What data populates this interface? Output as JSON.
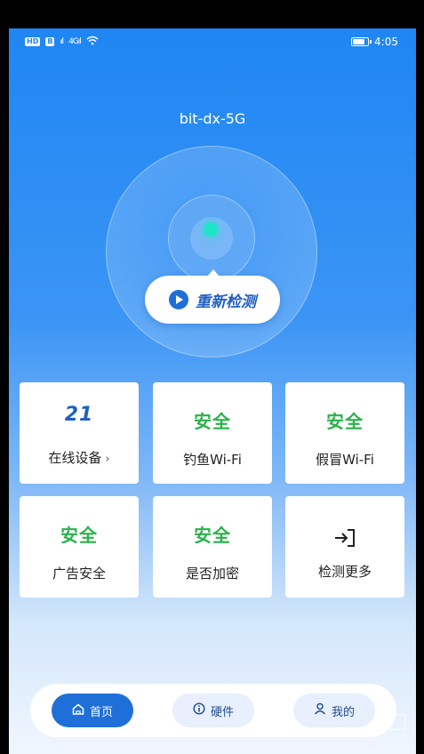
{
  "status_bar": {
    "left_badges": [
      "HD",
      "B"
    ],
    "signal_text": "4G",
    "time": "4:05",
    "battery_level": 0.85
  },
  "network": {
    "ssid": "bit-dx-5G"
  },
  "recheck_button": {
    "label": "重新检测"
  },
  "cards": [
    {
      "value": "21",
      "label": "在线设备",
      "chevron": "›"
    },
    {
      "value": "安全",
      "label": "钓鱼Wi-Fi"
    },
    {
      "value": "安全",
      "label": "假冒Wi-Fi"
    },
    {
      "value": "安全",
      "label": "广告安全"
    },
    {
      "value": "安全",
      "label": "是否加密"
    },
    {
      "icon": "→]",
      "label": "检测更多"
    }
  ],
  "tabs": [
    {
      "icon": "⌂",
      "label": "首页",
      "active": true
    },
    {
      "icon": "ⓘ",
      "label": "硬件",
      "active": false
    },
    {
      "icon": "♙",
      "label": "我的",
      "active": false
    }
  ],
  "colors": {
    "primary": "#1f86f3",
    "safe_green": "#2bb24c",
    "accent_dot": "#1de6c8"
  }
}
